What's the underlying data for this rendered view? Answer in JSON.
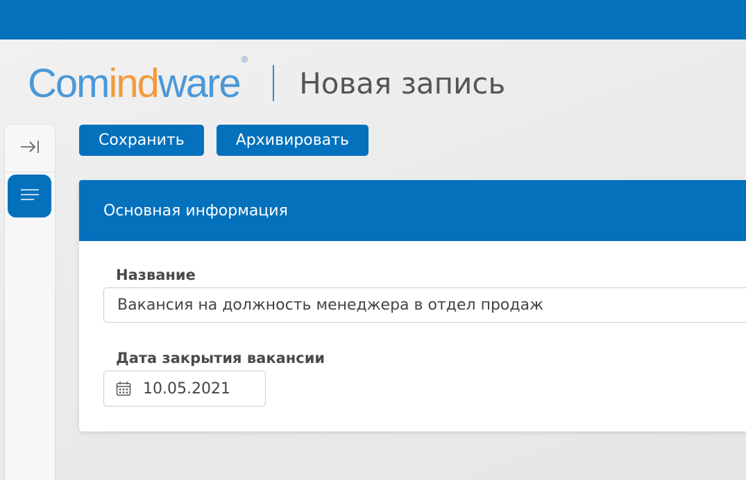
{
  "logo": {
    "part1": "Com",
    "part2": "ind",
    "part3": "ware",
    "registered": "®",
    "colors": {
      "blue": "#4a98d8",
      "orange": "#f39a3c"
    }
  },
  "page": {
    "title": "Новая запись"
  },
  "sidebar": {
    "collapse_icon": "collapse-right-icon",
    "menu_icon": "menu-icon"
  },
  "toolbar": {
    "save_label": "Сохранить",
    "archive_label": "Архивировать"
  },
  "card": {
    "title": "Основная информация",
    "fields": [
      {
        "label": "Название",
        "value": "Вакансия на должность менеджера в отдел продаж"
      },
      {
        "label": "Дата закрытия вакансии",
        "value": "10.05.2021",
        "icon": "calendar-icon"
      }
    ]
  },
  "theme": {
    "accent": "#0471bd",
    "background": "#ededed"
  }
}
